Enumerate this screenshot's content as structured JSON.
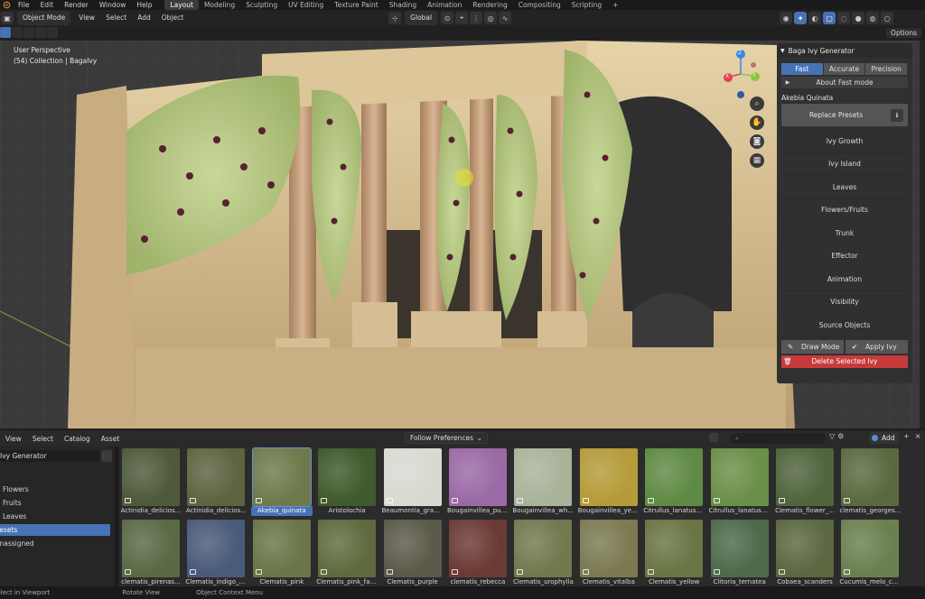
{
  "topbar": {
    "menus": [
      "File",
      "Edit",
      "Render",
      "Window",
      "Help"
    ],
    "workspaces": [
      "Layout",
      "Modeling",
      "Sculpting",
      "UV Editing",
      "Texture Paint",
      "Shading",
      "Animation",
      "Rendering",
      "Compositing",
      "Scripting",
      "+"
    ],
    "active_workspace": "Layout"
  },
  "viewport_header": {
    "mode": "Object Mode",
    "menus": [
      "View",
      "Select",
      "Add",
      "Object"
    ],
    "transform_orientation": "Global",
    "options_label": "Options"
  },
  "viewport": {
    "perspective_label": "User Perspective",
    "collection_label": "(54) Collection | Bagalvy"
  },
  "gizmo": {
    "z_label": "Z",
    "x_label": "X",
    "y_label": "Y",
    "colors": {
      "x": "#e0434f",
      "y": "#8cc63f",
      "z": "#3d86e8"
    }
  },
  "npanel": {
    "title": "Baga Ivy Generator",
    "modes": [
      "Fast",
      "Accurate",
      "Precision"
    ],
    "active_mode": "Fast",
    "about_label": "About Fast mode",
    "preset_name": "Akebia Quinata",
    "replace_label": "Replace Presets",
    "sections": [
      "Ivy Growth",
      "Ivy Island",
      "Leaves",
      "Flowers/Fruits",
      "Trunk",
      "Effector",
      "Animation",
      "Visibility",
      "Source Objects"
    ],
    "draw_mode_label": "Draw Mode",
    "apply_label": "Apply Ivy",
    "delete_label": "Delete Selected Ivy",
    "delete_color": "#c83a3a"
  },
  "asset_browser": {
    "menus": [
      "View",
      "Select",
      "Catalog",
      "Asset"
    ],
    "import_method": "Follow Preferences",
    "add_label": "Add",
    "library": "Ivy Generator",
    "catalogs": [
      {
        "label": "Flowers",
        "selected": false
      },
      {
        "label": "Fruits",
        "selected": false
      },
      {
        "label": "Leaves",
        "selected": false
      },
      {
        "label": "Presets",
        "selected": true
      },
      {
        "label": "Unassigned",
        "selected": false
      }
    ],
    "row1": [
      {
        "label": "Actinidia_delicios...",
        "color": "#4f5a3a"
      },
      {
        "label": "Actinidia_delicios...",
        "color": "#5c6440"
      },
      {
        "label": "Akebia_quinata",
        "color": "#6f7a4c",
        "selected": true
      },
      {
        "label": "Aristolochia",
        "color": "#3f5a2c"
      },
      {
        "label": "Beaumontia_gran...",
        "color": "#d9d9d2"
      },
      {
        "label": "Bougainvillea_pur...",
        "color": "#9b6aa6"
      },
      {
        "label": "Bougainvillea_white",
        "color": "#a9b39a"
      },
      {
        "label": "Bougainvillea_yell...",
        "color": "#b59b3a"
      },
      {
        "label": "Citrullus_lanatus_f...",
        "color": "#5f8a45"
      },
      {
        "label": "Citrullus_lanatus_f...",
        "color": "#6a8f49"
      },
      {
        "label": "Clematis_flower_...",
        "color": "#51643d"
      },
      {
        "label": "clematis_georges...",
        "color": "#5a6a40"
      }
    ],
    "row2": [
      {
        "label": "clematis_pirenas...",
        "color": "#596a45"
      },
      {
        "label": "Clematis_indigo_c...",
        "color": "#4a5a7a"
      },
      {
        "label": "Clematis_pink",
        "color": "#6a7548"
      },
      {
        "label": "Clematis_pink_fan...",
        "color": "#5f6b3f"
      },
      {
        "label": "Clematis_purple",
        "color": "#5b5a4a"
      },
      {
        "label": "clematis_rebecca",
        "color": "#6b3a35"
      },
      {
        "label": "Clematis_urophylla",
        "color": "#71794f"
      },
      {
        "label": "Clematis_vitalba",
        "color": "#7b7a52"
      },
      {
        "label": "Clematis_yellow",
        "color": "#6a7545"
      },
      {
        "label": "Clitoria_ternatea",
        "color": "#4d6a4a"
      },
      {
        "label": "Cobaea_scanders",
        "color": "#5b6842"
      },
      {
        "label": "Cucumis_melo_ca...",
        "color": "#6b8050"
      }
    ]
  },
  "status": {
    "items": [
      "Select in Viewport",
      "Rotate View",
      "Object Context Menu"
    ]
  }
}
